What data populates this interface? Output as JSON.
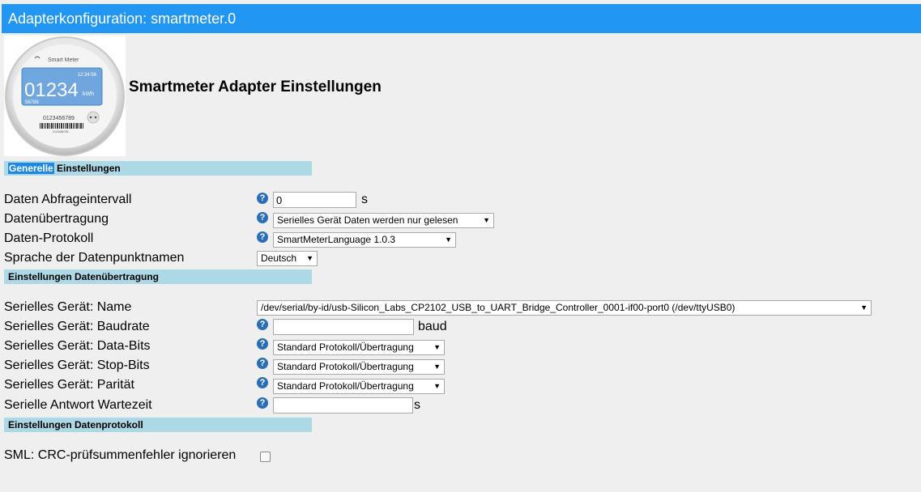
{
  "window": {
    "title": "Adapterkonfiguration: smartmeter.0"
  },
  "header": {
    "title": "Smartmeter Adapter Einstellungen"
  },
  "logo": {
    "brand": "Smart Meter",
    "time": "12:34:56",
    "reading": "01234",
    "unit": "kWh",
    "subreading": "56789",
    "serial": "0123456789",
    "barcode_text": "0123456789"
  },
  "sections": {
    "general": {
      "highlight": "Generelle",
      "rest": " Einstellungen"
    },
    "transfer": {
      "label": "Einstellungen Datenübertragung"
    },
    "protocol": {
      "label": "Einstellungen Datenprotokoll"
    }
  },
  "help_glyph": "?",
  "general": {
    "interval_label": "Daten Abfrageintervall",
    "interval_value": "0",
    "interval_unit": "s",
    "transfer_label": "Datenübertragung",
    "transfer_value": "Serielles Gerät Daten werden nur gelesen",
    "protocol_label": "Daten-Protokoll",
    "protocol_value": "SmartMeterLanguage 1.0.3",
    "language_label": "Sprache der Datenpunktnamen",
    "language_value": "Deutsch"
  },
  "transfer": {
    "device_label": "Serielles Gerät: Name",
    "device_value": "/dev/serial/by-id/usb-Silicon_Labs_CP2102_USB_to_UART_Bridge_Controller_0001-if00-port0 (/dev/ttyUSB0)",
    "baud_label": "Serielles Gerät: Baudrate",
    "baud_value": "",
    "baud_unit": "baud",
    "databits_label": "Serielles Gerät: Data-Bits",
    "databits_value": "Standard Protokoll/Übertragung",
    "stopbits_label": "Serielles Gerät: Stop-Bits",
    "stopbits_value": "Standard Protokoll/Übertragung",
    "parity_label": "Serielles Gerät: Parität",
    "parity_value": "Standard Protokoll/Übertragung",
    "wait_label": "Serielle Antwort Wartezeit",
    "wait_value": "",
    "wait_unit": "s"
  },
  "protocol": {
    "crc_label": "SML: CRC-prüfsummenfehler ignorieren",
    "crc_checked": false
  },
  "colors": {
    "titlebar": "#2196f3",
    "section_bar": "#add8e6",
    "help_icon": "#2a6fb6",
    "background": "#efefef"
  }
}
